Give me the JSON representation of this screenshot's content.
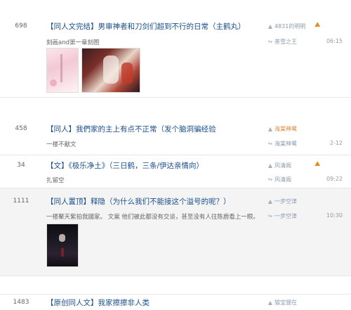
{
  "accent": "#1a4f8b",
  "hot_color": "#e0901a",
  "threads": [
    {
      "reply_count": "698",
      "tag": "【同人文完结】",
      "title": "男审神者和刀剑们超到不行的日常（主鹤丸）",
      "subtitle": "刻画and第一章刻图",
      "author": "4831的明明",
      "last_replier": "茶雪之王",
      "last_time": "06:15",
      "hot_icon": "hot-flame-icon",
      "images": [
        "cherry-blossom-poster",
        "anime-group-illustration"
      ]
    },
    {
      "reply_count": "458",
      "tag": "【同人】",
      "title": "我們家的主上有点不正常（发个脑洞骗经验",
      "subtitle": "一楼不献文",
      "author": "海棠神鹭",
      "last_replier": "海棠神鹭",
      "last_time": "2-12",
      "author_highlight": "#d7893c"
    },
    {
      "reply_count": "34",
      "tag": "【文】",
      "title": "《极乐净土》（三日鹤，三条/伊达亲情向）",
      "subtitle": "扎留空",
      "author": "风清阁",
      "last_replier": "风清阁",
      "last_time": "09:22",
      "hot_icon": "hot-flame-icon"
    },
    {
      "reply_count": "1111",
      "tag": "【同人置顶】",
      "title": "释隐（为什么我们不能接这个溢号的呢？）",
      "subtitle": "一楼聚天紫拍我國家。 文案 他们被此都没有交谈，甚至没有人往陈鹿看上一眼。 付表...",
      "author": "一步空津",
      "last_replier": "一步空津",
      "last_time": "10:30",
      "images": [
        "dark-character-art"
      ]
    },
    {
      "reply_count": "1483",
      "tag": "【原创同人文】",
      "title": "我家擦擦非人类",
      "author": "猫宝狸在"
    }
  ]
}
